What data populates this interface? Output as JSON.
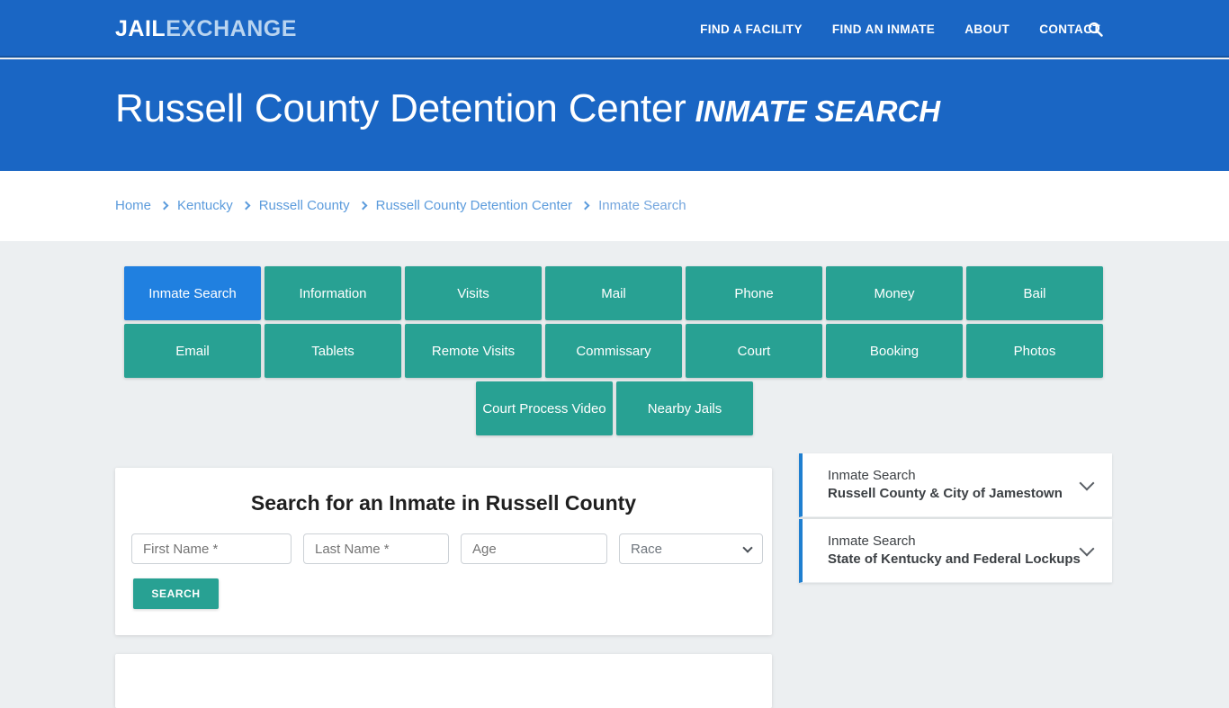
{
  "brand": {
    "part1": "JAIL",
    "part2": "EXCHANGE"
  },
  "nav": {
    "items": [
      {
        "label": "FIND A FACILITY"
      },
      {
        "label": "FIND AN INMATE"
      },
      {
        "label": "ABOUT"
      },
      {
        "label": "CONTACT"
      }
    ],
    "search_icon": "search-icon"
  },
  "hero": {
    "facility": "Russell County Detention Center",
    "section": "INMATE SEARCH"
  },
  "breadcrumb": {
    "items": [
      {
        "label": "Home",
        "current": false
      },
      {
        "label": "Kentucky",
        "current": false
      },
      {
        "label": "Russell County",
        "current": false
      },
      {
        "label": "Russell County Detention Center",
        "current": false
      },
      {
        "label": "Inmate Search",
        "current": true
      }
    ]
  },
  "tabs": {
    "row1": [
      {
        "label": "Inmate Search",
        "active": true
      },
      {
        "label": "Information",
        "active": false
      },
      {
        "label": "Visits",
        "active": false
      },
      {
        "label": "Mail",
        "active": false
      },
      {
        "label": "Phone",
        "active": false
      },
      {
        "label": "Money",
        "active": false
      },
      {
        "label": "Bail",
        "active": false
      }
    ],
    "row2": [
      {
        "label": "Email",
        "active": false
      },
      {
        "label": "Tablets",
        "active": false
      },
      {
        "label": "Remote Visits",
        "active": false
      },
      {
        "label": "Commissary",
        "active": false
      },
      {
        "label": "Court",
        "active": false
      },
      {
        "label": "Booking",
        "active": false
      },
      {
        "label": "Photos",
        "active": false
      }
    ],
    "row3": [
      {
        "label": "Court Process Video",
        "active": false
      },
      {
        "label": "Nearby Jails",
        "active": false
      }
    ]
  },
  "search_card": {
    "title": "Search for an Inmate in Russell County",
    "first_name_placeholder": "First Name *",
    "last_name_placeholder": "Last Name *",
    "age_placeholder": "Age",
    "race_selected": "Race",
    "submit_label": "SEARCH"
  },
  "sidebar": {
    "accordions": [
      {
        "line1": "Inmate Search",
        "line2": "Russell County & City of Jamestown",
        "icon": "chevron-down-icon"
      },
      {
        "line1": "Inmate Search",
        "line2": "State of Kentucky and Federal Lockups",
        "icon": "chevron-down-icon"
      }
    ]
  },
  "colors": {
    "header_blue": "#1a66c4",
    "tab_teal": "#28a193",
    "tab_active_blue": "#2080e0",
    "accent_blue": "#1f7fd0",
    "page_bg": "#eceff1"
  }
}
